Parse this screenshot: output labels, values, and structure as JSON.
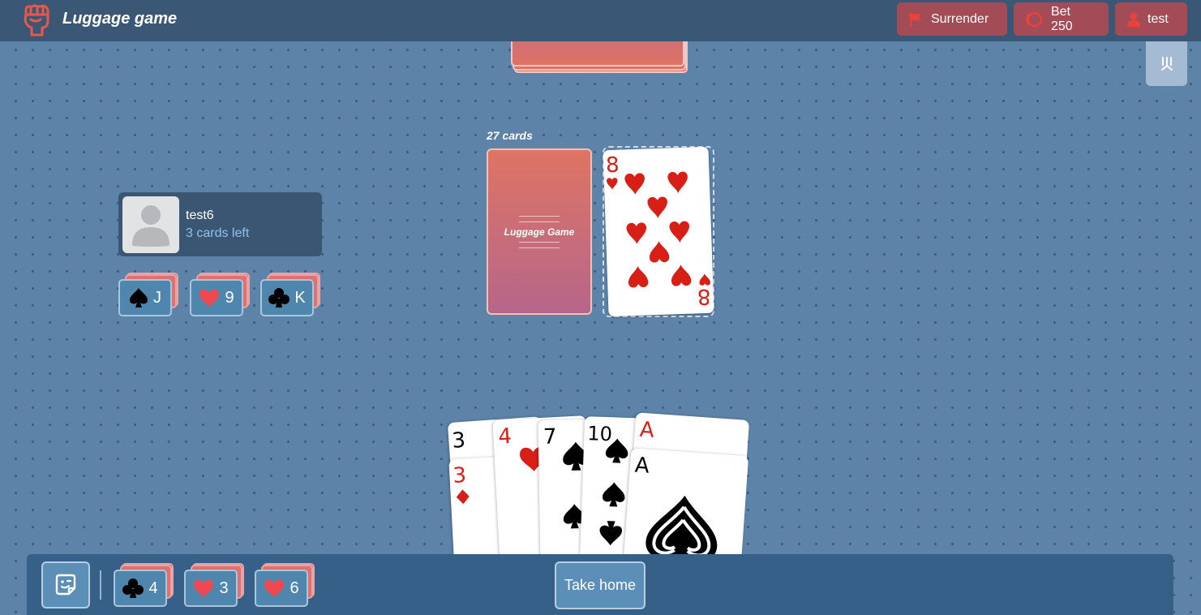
{
  "header": {
    "title": "Luggage game",
    "surrender_label": "Surrender",
    "bet_label": "Bet 250",
    "user_label": "test"
  },
  "table": {
    "deck_count": "27 cards",
    "deck_back_label": "Luggage Game",
    "discard_top": {
      "rank": "8",
      "suit": "hearts"
    }
  },
  "opponent": {
    "name": "test6",
    "cards_left": "3 cards left",
    "open_cards": [
      {
        "suit": "spades",
        "rank": "J"
      },
      {
        "suit": "hearts",
        "rank": "9"
      },
      {
        "suit": "clubs",
        "rank": "K"
      }
    ]
  },
  "hand": [
    {
      "rank": "3",
      "suit": "spades"
    },
    {
      "rank": "3",
      "suit": "diamonds"
    },
    {
      "rank": "4",
      "suit": "hearts"
    },
    {
      "rank": "7",
      "suit": "spades"
    },
    {
      "rank": "10",
      "suit": "spades"
    },
    {
      "rank": "A",
      "suit": "hearts"
    },
    {
      "rank": "A",
      "suit": "spades"
    }
  ],
  "player": {
    "open_cards": [
      {
        "suit": "clubs",
        "rank": "4"
      },
      {
        "suit": "hearts",
        "rank": "3"
      },
      {
        "suit": "hearts",
        "rank": "6"
      }
    ]
  },
  "actions": {
    "take_home_label": "Take home"
  },
  "colors": {
    "background": "#5d83a8",
    "topbar": "#3a5875",
    "button_red": "#a44b58",
    "card_back": "#de7264",
    "suit_red": "#d81f16"
  }
}
